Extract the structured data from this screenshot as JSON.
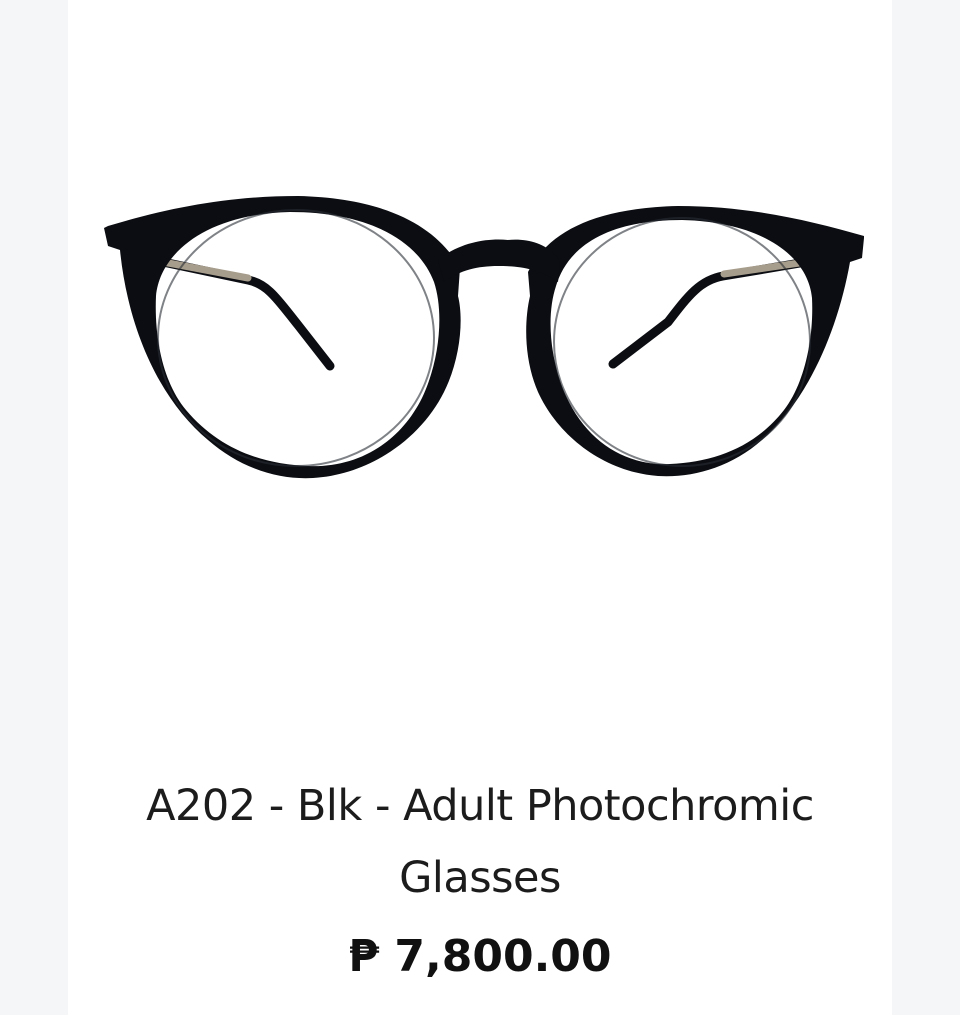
{
  "product": {
    "image_alt": "black round eyeglasses frame",
    "title": "A202 - Blk - Adult Photochromic Glasses",
    "price": "₱ 7,800.00"
  },
  "colors": {
    "frame": "#0b0d12",
    "temple": "#a79d8c",
    "card_bg": "#ffffff",
    "page_bg": "#f5f6f8"
  }
}
